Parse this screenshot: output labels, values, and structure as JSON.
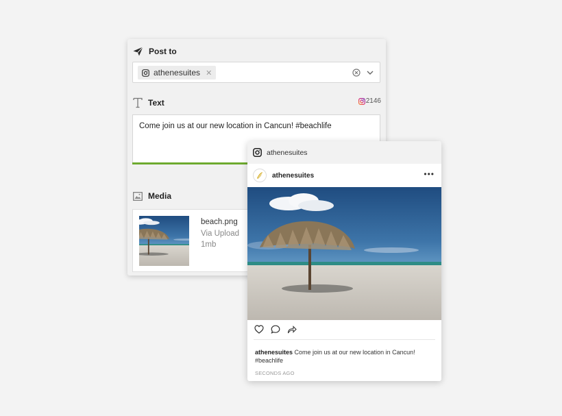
{
  "composer": {
    "post_to_label": "Post to",
    "selected_account": "athenesuites",
    "text_label": "Text",
    "char_count": "2146",
    "text_value": "Come join us at our new location in Cancun! #beachlife",
    "text_progress": 0.585,
    "media_label": "Media",
    "media": {
      "file_name": "beach.png",
      "source": "Via Upload",
      "size": "1mb"
    }
  },
  "preview": {
    "account": "athenesuites",
    "post_user": "athenesuites",
    "caption_user": "athenesuites",
    "caption_text": " Come join us at our new location in Cancun! #beachlife",
    "timestamp": "SECONDS AGO",
    "more_glyph": "•••"
  },
  "colors": {
    "progress": "#6eaa2f",
    "instagram_gradient_start": "#f58529",
    "instagram_gradient_end": "#8134af",
    "sky": "#2b5b8e",
    "sand": "#cfcac2"
  },
  "icons": {
    "post_to": "paper-plane-icon",
    "text": "text-t-icon",
    "media": "image-icon",
    "instagram": "instagram-icon",
    "like": "heart-icon",
    "comment": "comment-icon",
    "share": "share-icon"
  }
}
